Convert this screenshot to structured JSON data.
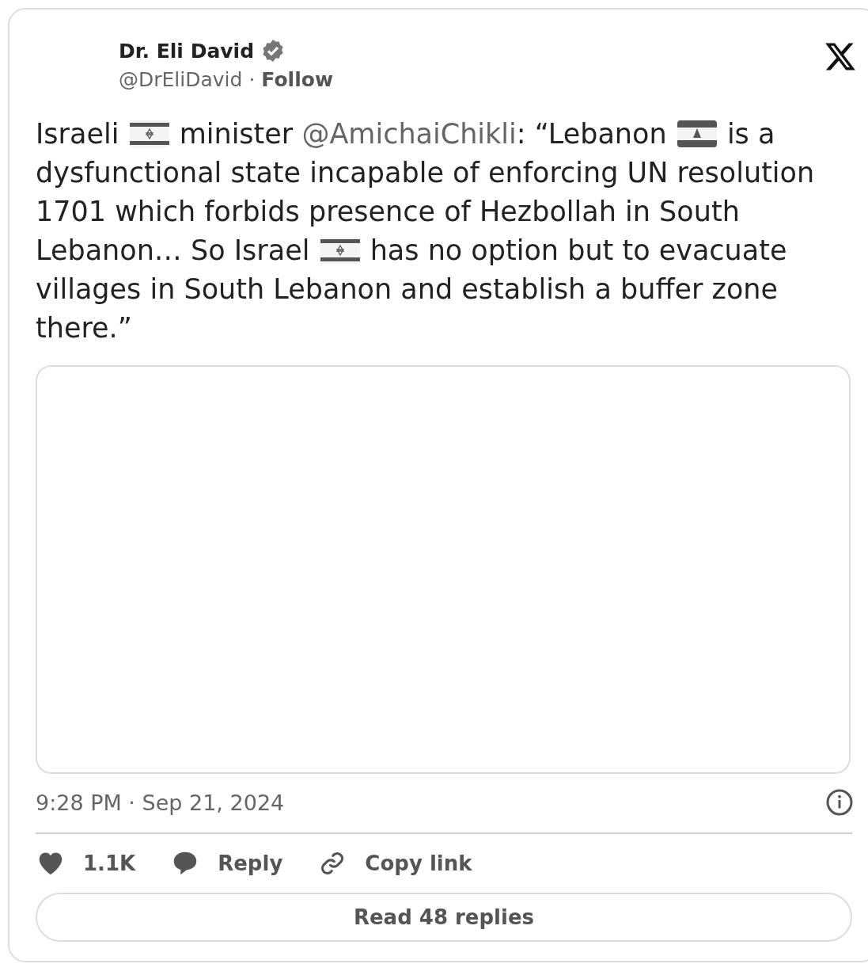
{
  "author": {
    "name": "Dr. Eli David",
    "verified": true,
    "handle": "@DrEliDavid",
    "separator": "·",
    "follow": "Follow"
  },
  "body": [
    {
      "kind": "text",
      "text": "Israeli "
    },
    {
      "kind": "israel_flag"
    },
    {
      "kind": "text",
      "text": " minister "
    },
    {
      "kind": "mention",
      "text": "@AmichaiChikli"
    },
    {
      "kind": "text",
      "text": ": “Lebanon "
    },
    {
      "kind": "lebanon_flag"
    },
    {
      "kind": "text",
      "text": " is a dysfunctional state incapable of enforcing UN resolution 1701 which forbids presence of Hezbollah in South Lebanon… So Israel "
    },
    {
      "kind": "israel_flag"
    },
    {
      "kind": "text",
      "text": " has no option but to evacuate villages in South Lebanon and establish a buffer zone there.”"
    }
  ],
  "timestamp": "9:28 PM · Sep 21, 2024",
  "actions": [
    {
      "kind": "like",
      "label": "1.1K"
    },
    {
      "kind": "reply",
      "label": "Reply"
    },
    {
      "kind": "copy",
      "label": "Copy link"
    }
  ],
  "read_replies": "Read 48 replies"
}
